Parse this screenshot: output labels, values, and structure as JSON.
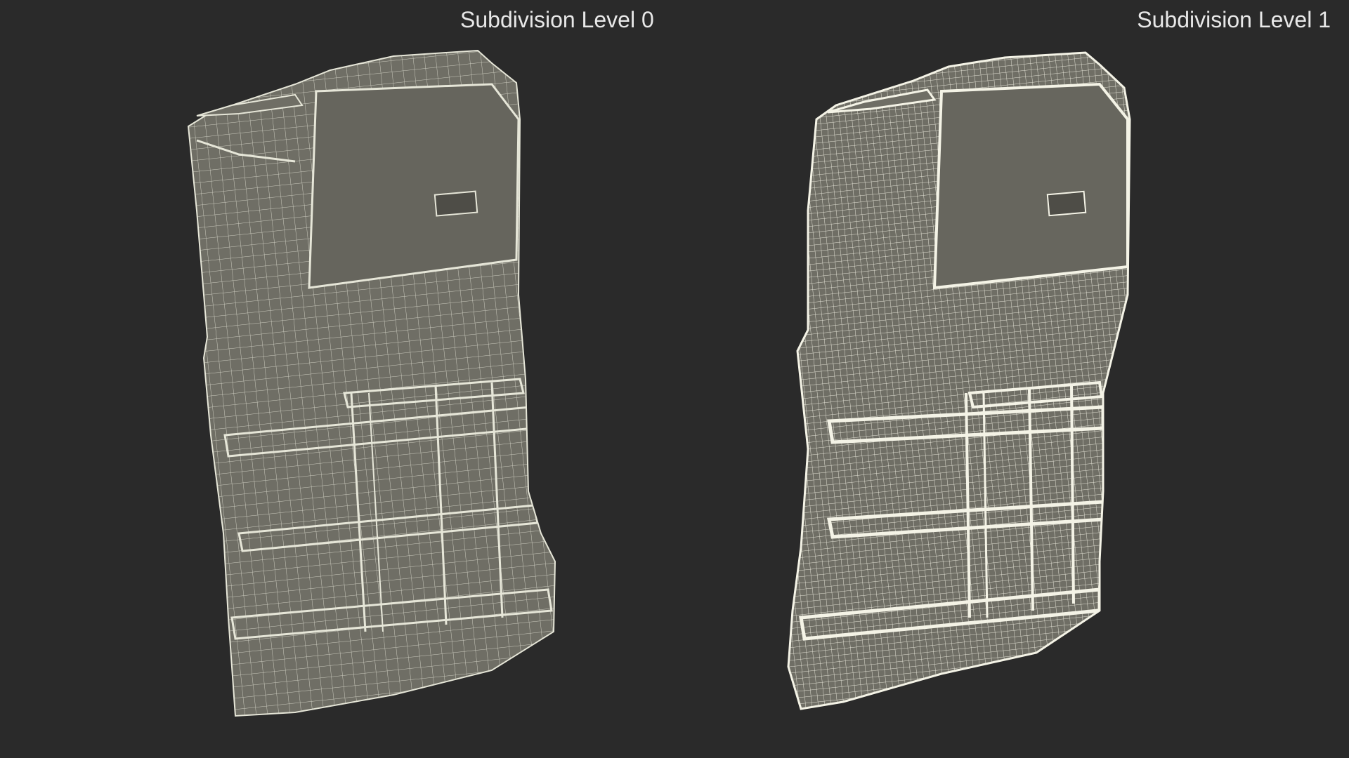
{
  "labels": {
    "left": "Subdivision Level 0",
    "right": "Subdivision Level 1"
  },
  "colors": {
    "background": "#2a2a2a",
    "model_fill": "#6f6e65",
    "model_fill_dark": "#5a5952",
    "wire_level0": "#dcdccf",
    "wire_level1": "#f0efe2",
    "label_text": "#e8e8e8"
  }
}
